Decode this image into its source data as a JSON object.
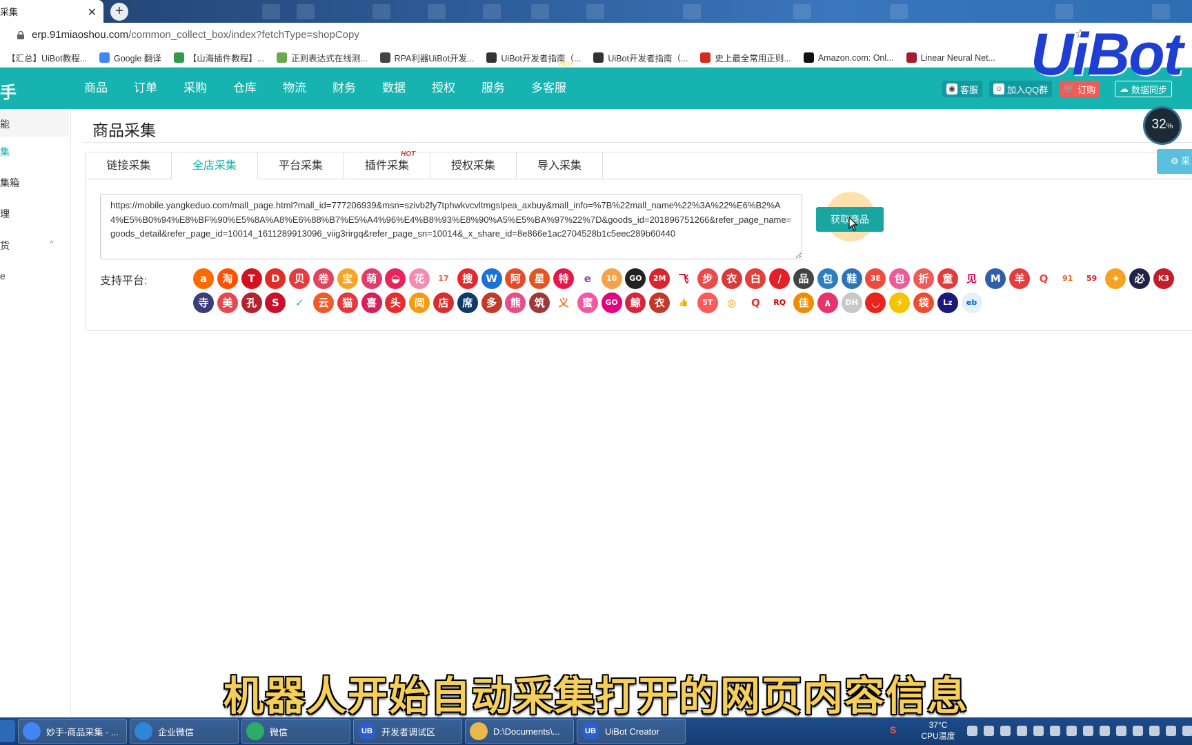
{
  "browser": {
    "tab_title": "采集",
    "tab_close": "✕",
    "new_tab": "+",
    "url_host": "erp.91miaoshou.com",
    "url_path": "/common_collect_box/index?fetchType=shopCopy",
    "star": "☆",
    "bookmarks": [
      {
        "label": "【汇总】UiBot教程...",
        "color": "#1a73e8"
      },
      {
        "label": "Google 翻译",
        "color": "#4285f4"
      },
      {
        "label": "【山海插件教程】...",
        "color": "#2e9c4a"
      },
      {
        "label": "正则表达式在线测...",
        "color": "#6aa84f"
      },
      {
        "label": "RPA利器UiBot开发...",
        "color": "#444444"
      },
      {
        "label": "UiBot开发者指南（...",
        "color": "#333333"
      },
      {
        "label": "UiBot开发者指南（...",
        "color": "#333333"
      },
      {
        "label": "史上最全常用正则...",
        "color": "#d52b1e"
      },
      {
        "label": "Amazon.com: Onl...",
        "color": "#111111"
      },
      {
        "label": "Linear Neural Net...",
        "color": "#a51d2d"
      }
    ]
  },
  "app": {
    "logo": "手",
    "nav": [
      "商品",
      "订单",
      "采购",
      "仓库",
      "物流",
      "财务",
      "数据",
      "授权",
      "服务",
      "多客服"
    ],
    "nav_hot": "HOT",
    "header_buttons": {
      "kefu": "客服",
      "qq_group": "加入QQ群",
      "order": "订购",
      "sync": "数据同步"
    }
  },
  "sidebar": {
    "items": [
      "能",
      "集",
      "集箱",
      "理",
      "货",
      "e"
    ],
    "chevron": "^"
  },
  "main": {
    "title": "商品采集",
    "tabs": [
      "链接采集",
      "全店采集",
      "平台采集",
      "插件采集",
      "授权采集",
      "导入采集"
    ],
    "tab_hot": "HOT",
    "url_value": "https://mobile.yangkeduo.com/mall_page.html?mall_id=777206939&msn=szivb2fy7tphwkvcvltmgslpea_axbuy&mall_info=%7B%22mall_name%22%3A%22%E6%B2%A4%E5%B0%94%E8%BF%90%E5%8A%A8%E6%88%B7%E5%A4%96%E4%B8%93%E8%90%A5%E5%BA%97%22%7D&goods_id=201896751266&refer_page_name=goods_detail&refer_page_id=10014_1611289913096_viig3rirgq&refer_page_sn=10014&_x_share_id=8e866e1ac2704528b1c5eec289b60440",
    "fetch_button": "获取商品",
    "support_label": "支持平台:",
    "side_action": "⚙ 采"
  },
  "platforms_row1": [
    {
      "g": "a",
      "c": "#ff6a00"
    },
    {
      "g": "淘",
      "c": "#ff5000"
    },
    {
      "g": "T",
      "c": "#d4121e"
    },
    {
      "g": "D",
      "c": "#e02e24"
    },
    {
      "g": "贝",
      "c": "#e93b3d"
    },
    {
      "g": "卷",
      "c": "#e0455f"
    },
    {
      "g": "宝",
      "c": "#f6a623"
    },
    {
      "g": "萌",
      "c": "#e13b6a"
    },
    {
      "g": "◒",
      "c": "#e8245b"
    },
    {
      "g": "花",
      "c": "#f28db2"
    },
    {
      "g": "17",
      "c": "#ffffff",
      "t": "#f25a2a"
    },
    {
      "g": "搜",
      "c": "#e5282e"
    },
    {
      "g": "W",
      "c": "#1a72d9"
    },
    {
      "g": "阿",
      "c": "#e64b2b"
    },
    {
      "g": "星",
      "c": "#e6551e"
    },
    {
      "g": "特",
      "c": "#e8174a"
    },
    {
      "g": "e",
      "c": "#ffffff",
      "t": "#8e44ad"
    },
    {
      "g": "10",
      "c": "#f7a14a"
    },
    {
      "g": "GO",
      "c": "#222222"
    },
    {
      "g": "2M",
      "c": "#d9262c"
    },
    {
      "g": "飞",
      "c": "#ffffff",
      "t": "#d0021b"
    },
    {
      "g": "步",
      "c": "#ed4a4a"
    },
    {
      "g": "衣",
      "c": "#d93a3a"
    },
    {
      "g": "白",
      "c": "#e3403a"
    },
    {
      "g": "/",
      "c": "#e61e25"
    },
    {
      "g": "品",
      "c": "#444444"
    },
    {
      "g": "包",
      "c": "#2d7fc1"
    },
    {
      "g": "鞋",
      "c": "#2c73b8"
    },
    {
      "g": "3E",
      "c": "#ef4a3c"
    },
    {
      "g": "包",
      "c": "#ee5a9a"
    },
    {
      "g": "折",
      "c": "#f25a58"
    },
    {
      "g": "童",
      "c": "#e53a3a"
    },
    {
      "g": "见",
      "c": "#ffffff",
      "t": "#e5004f"
    },
    {
      "g": "M",
      "c": "#2f5fa8"
    },
    {
      "g": "羊",
      "c": "#e53c3c"
    },
    {
      "g": "Q",
      "c": "#ffffff",
      "t": "#e8453c"
    },
    {
      "g": "91",
      "c": "#ffffff",
      "t": "#e85d1a"
    },
    {
      "g": "59",
      "c": "#ffffff",
      "t": "#d81e2c"
    },
    {
      "g": "✦",
      "c": "#f7a120"
    },
    {
      "g": "必",
      "c": "#222244"
    },
    {
      "g": "K3",
      "c": "#c31d2a"
    }
  ],
  "platforms_row2": [
    {
      "g": "寺",
      "c": "#3c3c7a"
    },
    {
      "g": "美",
      "c": "#e8474e"
    },
    {
      "g": "孔",
      "c": "#b0232f"
    },
    {
      "g": "S",
      "c": "#c8102e"
    },
    {
      "g": "✓",
      "c": "#ffffff",
      "t": "#1bb2c9"
    },
    {
      "g": "云",
      "c": "#ef5b29"
    },
    {
      "g": "猫",
      "c": "#e6383f"
    },
    {
      "g": "喜",
      "c": "#d81e5b"
    },
    {
      "g": "头",
      "c": "#e82b2d"
    },
    {
      "g": "阅",
      "c": "#f39c12"
    },
    {
      "g": "店",
      "c": "#d92d2d"
    },
    {
      "g": "席",
      "c": "#0d3b66"
    },
    {
      "g": "多",
      "c": "#c0392b"
    },
    {
      "g": "熊",
      "c": "#e74c8b"
    },
    {
      "g": "筑",
      "c": "#9b3a3a"
    },
    {
      "g": "义",
      "c": "#ffffff",
      "t": "#e67e22"
    },
    {
      "g": "蜜",
      "c": "#f259a5"
    },
    {
      "g": "GO",
      "c": "#e4007f"
    },
    {
      "g": "鲸",
      "c": "#d6263d"
    },
    {
      "g": "衣",
      "c": "#c0392b"
    },
    {
      "g": "👍",
      "c": "#ffffff",
      "t": "#e74c3c"
    },
    {
      "g": "5T",
      "c": "#ff5a5a"
    },
    {
      "g": "◎",
      "c": "#ffffff",
      "t": "#e0a000"
    },
    {
      "g": "Q",
      "c": "#ffffff",
      "t": "#e83030"
    },
    {
      "g": "RQ",
      "c": "#ffffff",
      "t": "#d40000"
    },
    {
      "g": "佳",
      "c": "#f08c00"
    },
    {
      "g": "∧",
      "c": "#e8336d"
    },
    {
      "g": "DH",
      "c": "#c8c8c8"
    },
    {
      "g": "◡",
      "c": "#e8251c"
    },
    {
      "g": "⚡",
      "c": "#f5c400"
    },
    {
      "g": "袋",
      "c": "#ee4d2d"
    },
    {
      "g": "Lz",
      "c": "#1a1a7a"
    },
    {
      "g": "eb",
      "c": "#e6f0fb",
      "t": "#0064d2"
    }
  ],
  "overlay": {
    "uibot_logo": "UiBot",
    "cpu_percent": "32",
    "cpu_unit": "%",
    "subtitle": "机器人开始自动采集打开的网页内容信息"
  },
  "taskbar": {
    "items": [
      {
        "label": "妙手-商品采集 - ...",
        "icon_color": "#4285f4",
        "icon": ""
      },
      {
        "label": "企业微信",
        "icon_color": "#2f86d6",
        "icon": ""
      },
      {
        "label": "微信",
        "icon_color": "#2aae67",
        "icon": ""
      },
      {
        "label": "开发者调试区",
        "icon_color": "#2c5fc9",
        "icon": "UB"
      },
      {
        "label": "D:\\Documents\\...",
        "icon_color": "#e8b949",
        "icon": ""
      },
      {
        "label": "UiBot Creator",
        "icon_color": "#2c5fc9",
        "icon": "UB"
      }
    ],
    "temperature": "37°C",
    "temp_label": "CPU温度",
    "ime": "S"
  }
}
